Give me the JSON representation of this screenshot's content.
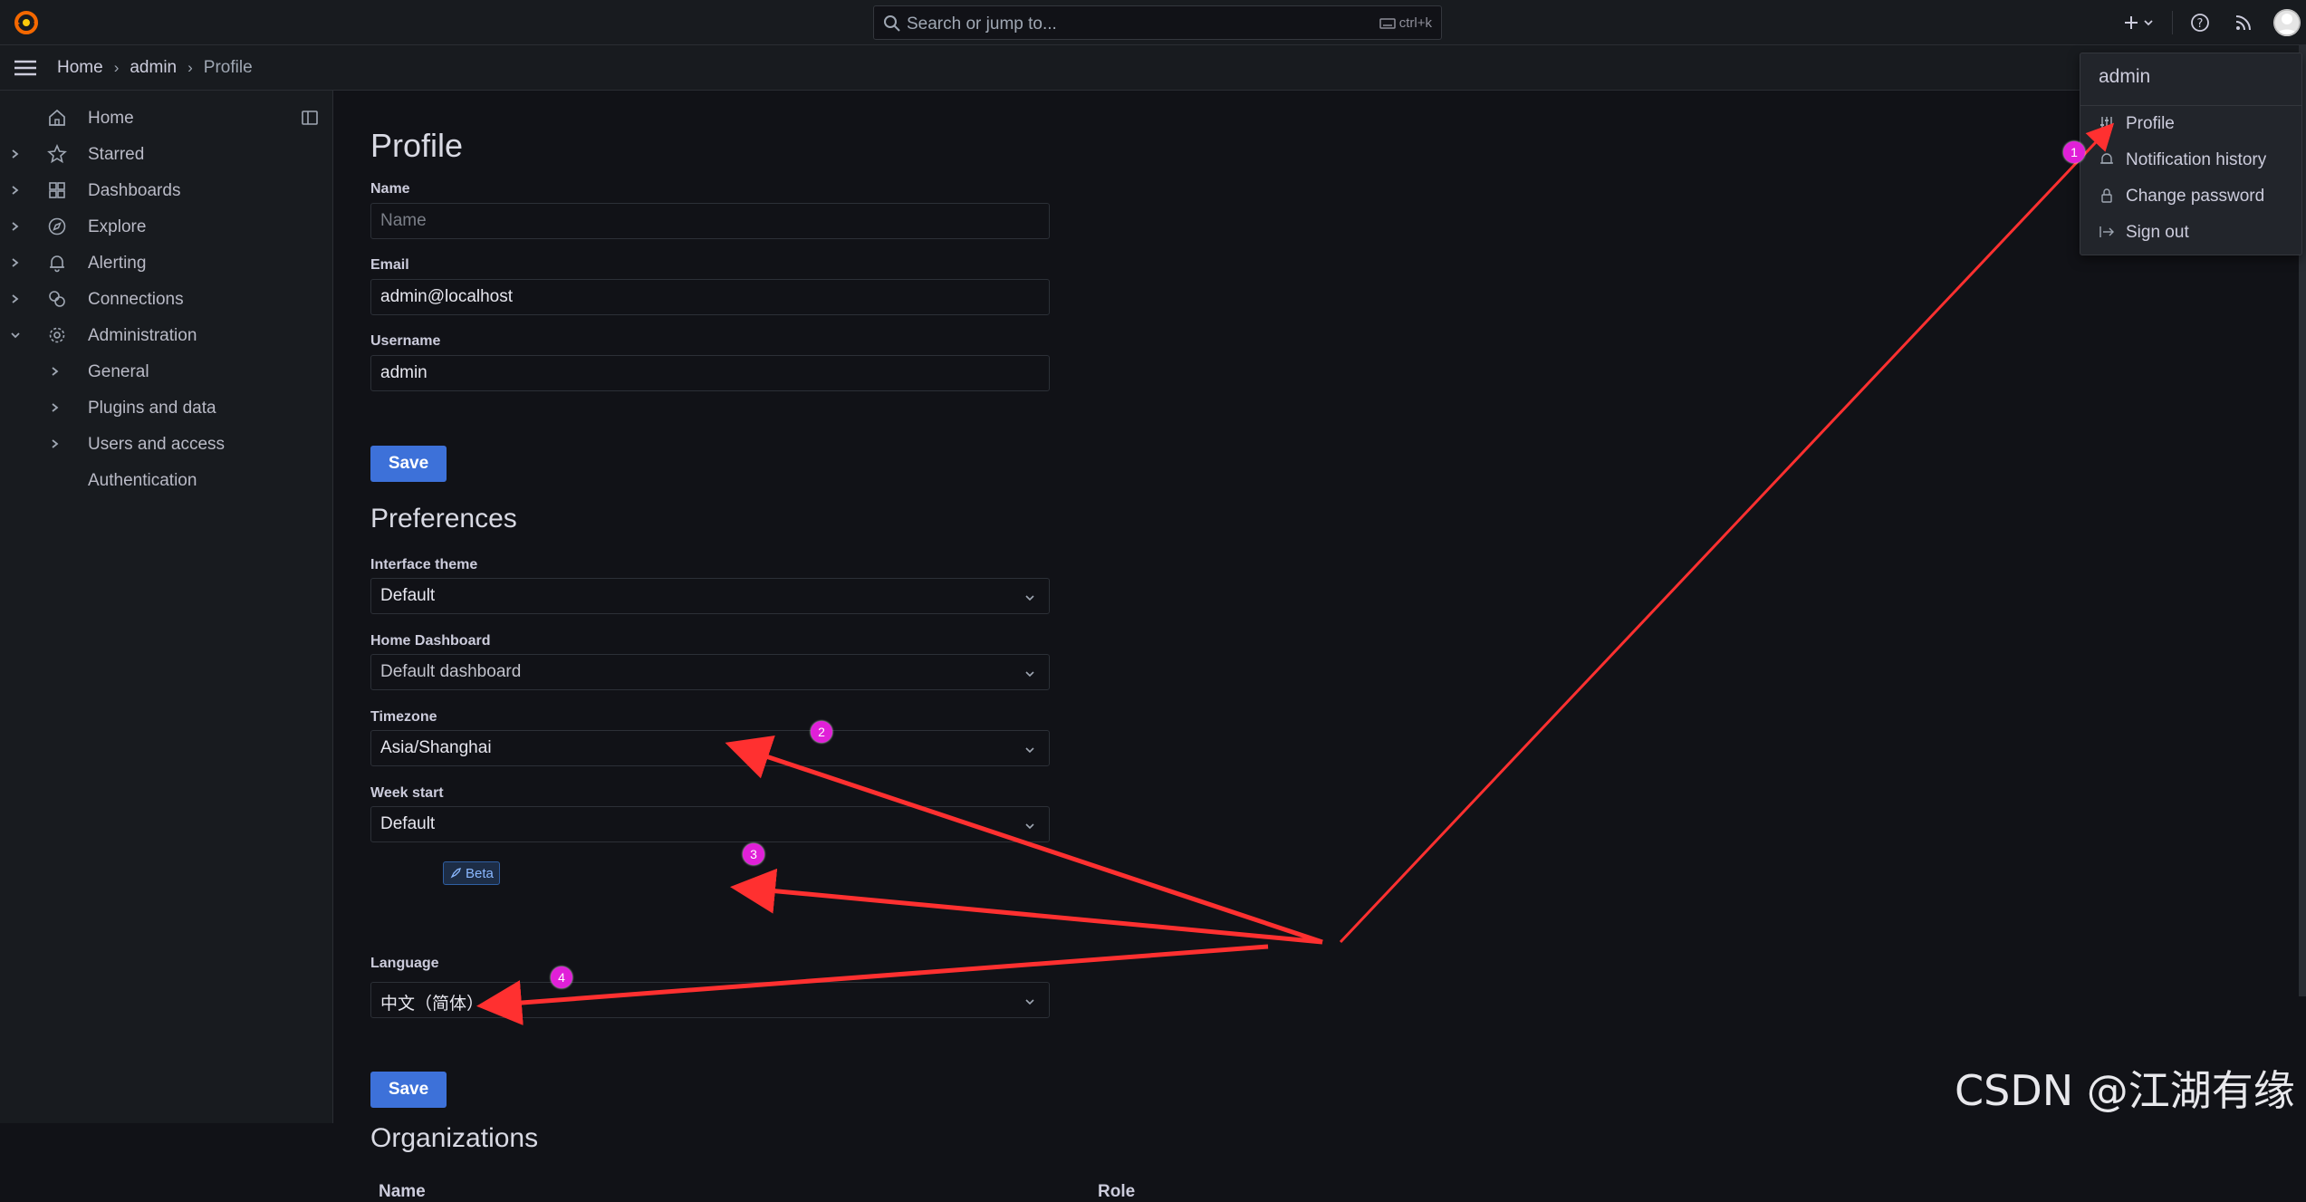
{
  "topbar": {
    "search_placeholder": "Search or jump to...",
    "shortcut": "ctrl+k"
  },
  "breadcrumb": {
    "home": "Home",
    "user": "admin",
    "current": "Profile"
  },
  "sidebar": {
    "items": [
      {
        "label": "Home",
        "icon": "home-icon"
      },
      {
        "label": "Starred",
        "icon": "star-icon"
      },
      {
        "label": "Dashboards",
        "icon": "grid-icon"
      },
      {
        "label": "Explore",
        "icon": "compass-icon"
      },
      {
        "label": "Alerting",
        "icon": "bell-icon"
      },
      {
        "label": "Connections",
        "icon": "link-icon"
      },
      {
        "label": "Administration",
        "icon": "gear-icon"
      }
    ],
    "sub_items": [
      "General",
      "Plugins and data",
      "Users and access",
      "Authentication"
    ]
  },
  "profile": {
    "title": "Profile",
    "name_label": "Name",
    "name_placeholder": "Name",
    "email_label": "Email",
    "email_value": "admin@localhost",
    "username_label": "Username",
    "username_value": "admin",
    "save_label": "Save"
  },
  "preferences": {
    "title": "Preferences",
    "theme_label": "Interface theme",
    "theme_value": "Default",
    "home_label": "Home Dashboard",
    "home_value": "Default dashboard",
    "tz_label": "Timezone",
    "tz_value": "Asia/Shanghai",
    "week_label": "Week start",
    "week_value": "Default",
    "lang_label": "Language",
    "lang_badge": "Beta",
    "lang_value": "中文（简体）",
    "save_label": "Save"
  },
  "organizations": {
    "title": "Organizations",
    "columns": [
      "Name",
      "Role"
    ]
  },
  "user_menu": {
    "header": "admin",
    "items": [
      {
        "label": "Profile",
        "icon": "sliders-icon"
      },
      {
        "label": "Notification history",
        "icon": "bell-icon"
      },
      {
        "label": "Change password",
        "icon": "lock-icon"
      },
      {
        "label": "Sign out",
        "icon": "sign-out-icon"
      }
    ]
  },
  "annotations": [
    "1",
    "2",
    "3",
    "4"
  ],
  "watermark": "CSDN @江湖有缘",
  "colors": {
    "primary": "#3d71d9",
    "background": "#111217",
    "annotation": "#ff3030",
    "badge": "#e020d8"
  }
}
